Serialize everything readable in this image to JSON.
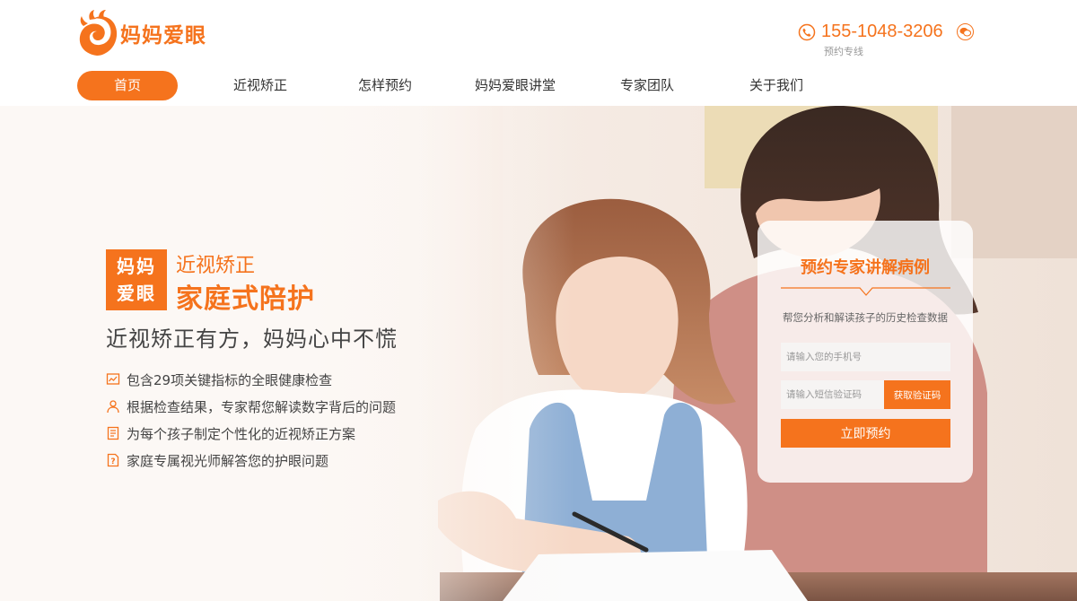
{
  "brand": {
    "name": "妈妈爱眼",
    "accent": "#f5731d"
  },
  "contact": {
    "phone": "155-1048-3206",
    "phone_label": "预约专线",
    "phone_icon": "phone-icon",
    "wechat_icon": "wechat-icon"
  },
  "nav": {
    "items": [
      {
        "label": "首页",
        "active": true
      },
      {
        "label": "近视矫正"
      },
      {
        "label": "怎样预约"
      },
      {
        "label": "妈妈爱眼讲堂"
      },
      {
        "label": "专家团队"
      },
      {
        "label": "关于我们"
      }
    ]
  },
  "hero": {
    "badge": [
      "妈妈",
      "爱眼"
    ],
    "title_line1": "近视矫正",
    "title_line2": "家庭式陪护",
    "subtitle": "近视矫正有方，妈妈心中不慌",
    "features": [
      {
        "icon": "chart-icon",
        "text": "包含29项关键指标的全眼健康检查"
      },
      {
        "icon": "person-icon",
        "text": "根据检查结果，专家帮您解读数字背后的问题"
      },
      {
        "icon": "plan-document-icon",
        "text": "为每个孩子制定个性化的近视矫正方案"
      },
      {
        "icon": "question-document-icon",
        "text": "家庭专属视光师解答您的护眼问题"
      }
    ]
  },
  "form": {
    "title": "预约专家讲解病例",
    "description": "帮您分析和解读孩子的历史检查数据",
    "phone_placeholder": "请输入您的手机号",
    "code_placeholder": "请输入短信验证码",
    "get_code_label": "获取验证码",
    "submit_label": "立即预约"
  }
}
